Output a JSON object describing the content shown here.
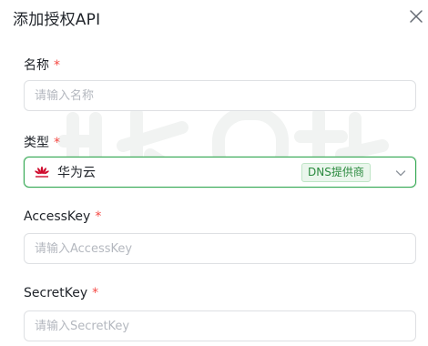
{
  "dialog": {
    "title": "添加授权API"
  },
  "form": {
    "name": {
      "label": "名称",
      "required_mark": "*",
      "placeholder": "请输入名称"
    },
    "type": {
      "label": "类型",
      "required_mark": "*",
      "selected_value": "华为云",
      "badge": "DNS提供商",
      "brand_icon": "huawei-logo-icon"
    },
    "access_key": {
      "label": "AccessKey",
      "required_mark": "*",
      "placeholder": "请输入AccessKey"
    },
    "secret_key": {
      "label": "SecretKey",
      "required_mark": "*",
      "placeholder": "请输入SecretKey"
    }
  },
  "colors": {
    "accent_green": "#34a853",
    "badge_bg": "#eaf6ec",
    "required_red": "#f54a45",
    "huawei_red": "#cf0a2c"
  }
}
